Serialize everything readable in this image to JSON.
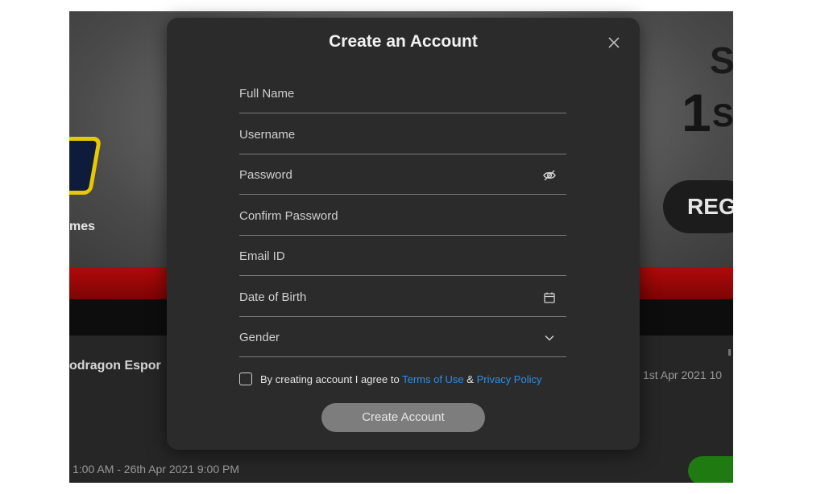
{
  "background": {
    "hero_left_text": "mes",
    "hero_right_letters": [
      "S",
      "1",
      "S"
    ],
    "register_button_label": "REG",
    "event_name": "odragon Espor",
    "event_date_right": "1st Apr 2021 10",
    "event_time_range": "1:00 AM - 26th Apr 2021 9:00 PM"
  },
  "modal": {
    "title": "Create an Account",
    "fields": [
      {
        "placeholder": "Full Name"
      },
      {
        "placeholder": "Username"
      },
      {
        "placeholder": "Password",
        "icon": "eye-slash-icon"
      },
      {
        "placeholder": "Confirm Password"
      },
      {
        "placeholder": "Email ID"
      },
      {
        "placeholder": "Date of Birth",
        "icon": "calendar-icon"
      },
      {
        "placeholder": "Gender",
        "icon": "chevron-down-icon"
      }
    ],
    "agree_prefix": "By creating account I agree to ",
    "terms_link": "Terms of Use",
    "amp": " & ",
    "privacy_link": "Privacy Policy",
    "submit_label": "Create Account"
  },
  "colors": {
    "modal_bg": "#2b2b2b",
    "link": "#2d8fe6",
    "submit_bg": "#7d7d7d",
    "accent_red": "#b10a0a",
    "accent_green": "#1f7a12"
  }
}
